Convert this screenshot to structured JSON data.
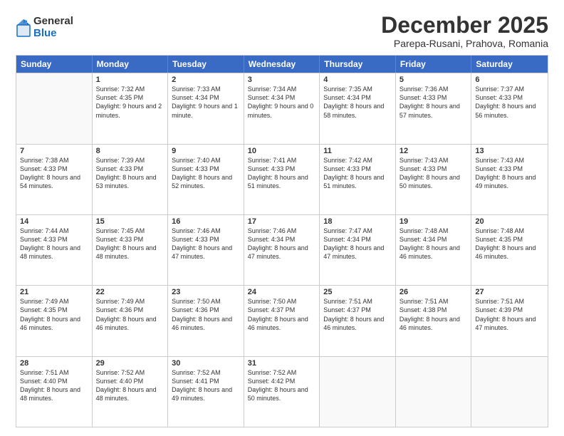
{
  "logo": {
    "general": "General",
    "blue": "Blue"
  },
  "header": {
    "month": "December 2025",
    "location": "Parepa-Rusani, Prahova, Romania"
  },
  "days_of_week": [
    "Sunday",
    "Monday",
    "Tuesday",
    "Wednesday",
    "Thursday",
    "Friday",
    "Saturday"
  ],
  "weeks": [
    [
      {
        "day": "",
        "sunrise": "",
        "sunset": "",
        "daylight": ""
      },
      {
        "day": "1",
        "sunrise": "Sunrise: 7:32 AM",
        "sunset": "Sunset: 4:35 PM",
        "daylight": "Daylight: 9 hours and 2 minutes."
      },
      {
        "day": "2",
        "sunrise": "Sunrise: 7:33 AM",
        "sunset": "Sunset: 4:34 PM",
        "daylight": "Daylight: 9 hours and 1 minute."
      },
      {
        "day": "3",
        "sunrise": "Sunrise: 7:34 AM",
        "sunset": "Sunset: 4:34 PM",
        "daylight": "Daylight: 9 hours and 0 minutes."
      },
      {
        "day": "4",
        "sunrise": "Sunrise: 7:35 AM",
        "sunset": "Sunset: 4:34 PM",
        "daylight": "Daylight: 8 hours and 58 minutes."
      },
      {
        "day": "5",
        "sunrise": "Sunrise: 7:36 AM",
        "sunset": "Sunset: 4:33 PM",
        "daylight": "Daylight: 8 hours and 57 minutes."
      },
      {
        "day": "6",
        "sunrise": "Sunrise: 7:37 AM",
        "sunset": "Sunset: 4:33 PM",
        "daylight": "Daylight: 8 hours and 56 minutes."
      }
    ],
    [
      {
        "day": "7",
        "sunrise": "Sunrise: 7:38 AM",
        "sunset": "Sunset: 4:33 PM",
        "daylight": "Daylight: 8 hours and 54 minutes."
      },
      {
        "day": "8",
        "sunrise": "Sunrise: 7:39 AM",
        "sunset": "Sunset: 4:33 PM",
        "daylight": "Daylight: 8 hours and 53 minutes."
      },
      {
        "day": "9",
        "sunrise": "Sunrise: 7:40 AM",
        "sunset": "Sunset: 4:33 PM",
        "daylight": "Daylight: 8 hours and 52 minutes."
      },
      {
        "day": "10",
        "sunrise": "Sunrise: 7:41 AM",
        "sunset": "Sunset: 4:33 PM",
        "daylight": "Daylight: 8 hours and 51 minutes."
      },
      {
        "day": "11",
        "sunrise": "Sunrise: 7:42 AM",
        "sunset": "Sunset: 4:33 PM",
        "daylight": "Daylight: 8 hours and 51 minutes."
      },
      {
        "day": "12",
        "sunrise": "Sunrise: 7:43 AM",
        "sunset": "Sunset: 4:33 PM",
        "daylight": "Daylight: 8 hours and 50 minutes."
      },
      {
        "day": "13",
        "sunrise": "Sunrise: 7:43 AM",
        "sunset": "Sunset: 4:33 PM",
        "daylight": "Daylight: 8 hours and 49 minutes."
      }
    ],
    [
      {
        "day": "14",
        "sunrise": "Sunrise: 7:44 AM",
        "sunset": "Sunset: 4:33 PM",
        "daylight": "Daylight: 8 hours and 48 minutes."
      },
      {
        "day": "15",
        "sunrise": "Sunrise: 7:45 AM",
        "sunset": "Sunset: 4:33 PM",
        "daylight": "Daylight: 8 hours and 48 minutes."
      },
      {
        "day": "16",
        "sunrise": "Sunrise: 7:46 AM",
        "sunset": "Sunset: 4:33 PM",
        "daylight": "Daylight: 8 hours and 47 minutes."
      },
      {
        "day": "17",
        "sunrise": "Sunrise: 7:46 AM",
        "sunset": "Sunset: 4:34 PM",
        "daylight": "Daylight: 8 hours and 47 minutes."
      },
      {
        "day": "18",
        "sunrise": "Sunrise: 7:47 AM",
        "sunset": "Sunset: 4:34 PM",
        "daylight": "Daylight: 8 hours and 47 minutes."
      },
      {
        "day": "19",
        "sunrise": "Sunrise: 7:48 AM",
        "sunset": "Sunset: 4:34 PM",
        "daylight": "Daylight: 8 hours and 46 minutes."
      },
      {
        "day": "20",
        "sunrise": "Sunrise: 7:48 AM",
        "sunset": "Sunset: 4:35 PM",
        "daylight": "Daylight: 8 hours and 46 minutes."
      }
    ],
    [
      {
        "day": "21",
        "sunrise": "Sunrise: 7:49 AM",
        "sunset": "Sunset: 4:35 PM",
        "daylight": "Daylight: 8 hours and 46 minutes."
      },
      {
        "day": "22",
        "sunrise": "Sunrise: 7:49 AM",
        "sunset": "Sunset: 4:36 PM",
        "daylight": "Daylight: 8 hours and 46 minutes."
      },
      {
        "day": "23",
        "sunrise": "Sunrise: 7:50 AM",
        "sunset": "Sunset: 4:36 PM",
        "daylight": "Daylight: 8 hours and 46 minutes."
      },
      {
        "day": "24",
        "sunrise": "Sunrise: 7:50 AM",
        "sunset": "Sunset: 4:37 PM",
        "daylight": "Daylight: 8 hours and 46 minutes."
      },
      {
        "day": "25",
        "sunrise": "Sunrise: 7:51 AM",
        "sunset": "Sunset: 4:37 PM",
        "daylight": "Daylight: 8 hours and 46 minutes."
      },
      {
        "day": "26",
        "sunrise": "Sunrise: 7:51 AM",
        "sunset": "Sunset: 4:38 PM",
        "daylight": "Daylight: 8 hours and 46 minutes."
      },
      {
        "day": "27",
        "sunrise": "Sunrise: 7:51 AM",
        "sunset": "Sunset: 4:39 PM",
        "daylight": "Daylight: 8 hours and 47 minutes."
      }
    ],
    [
      {
        "day": "28",
        "sunrise": "Sunrise: 7:51 AM",
        "sunset": "Sunset: 4:40 PM",
        "daylight": "Daylight: 8 hours and 48 minutes."
      },
      {
        "day": "29",
        "sunrise": "Sunrise: 7:52 AM",
        "sunset": "Sunset: 4:40 PM",
        "daylight": "Daylight: 8 hours and 48 minutes."
      },
      {
        "day": "30",
        "sunrise": "Sunrise: 7:52 AM",
        "sunset": "Sunset: 4:41 PM",
        "daylight": "Daylight: 8 hours and 49 minutes."
      },
      {
        "day": "31",
        "sunrise": "Sunrise: 7:52 AM",
        "sunset": "Sunset: 4:42 PM",
        "daylight": "Daylight: 8 hours and 50 minutes."
      },
      {
        "day": "",
        "sunrise": "",
        "sunset": "",
        "daylight": ""
      },
      {
        "day": "",
        "sunrise": "",
        "sunset": "",
        "daylight": ""
      },
      {
        "day": "",
        "sunrise": "",
        "sunset": "",
        "daylight": ""
      }
    ]
  ]
}
